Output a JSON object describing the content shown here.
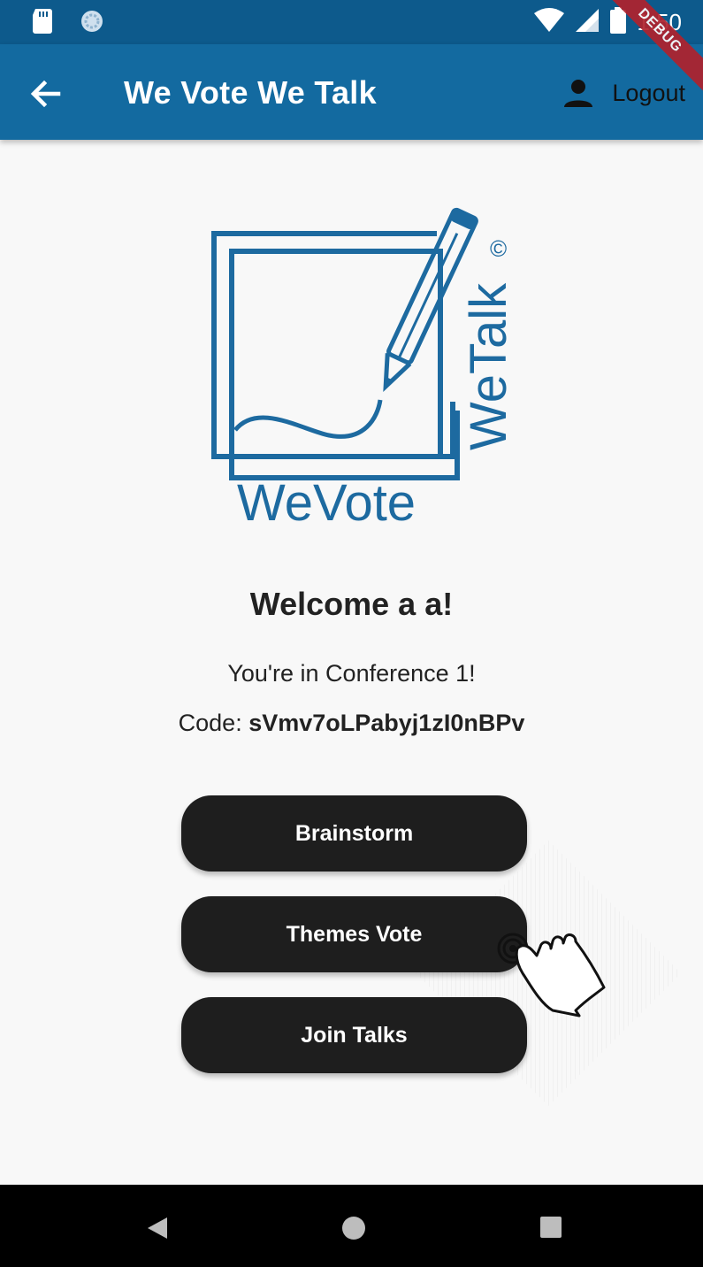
{
  "status_bar": {
    "time": "1:50",
    "icons": [
      "sd-card-icon",
      "sync-icon",
      "wifi-icon",
      "signal-icon",
      "battery-icon"
    ]
  },
  "app_bar": {
    "title": "We Vote We Talk",
    "logout_label": "Logout",
    "back_icon": "arrow-back-icon",
    "user_icon": "person-icon",
    "color": "#136aa0"
  },
  "debug_banner": "DEBUG",
  "logo": {
    "primary_text": "WeVote",
    "secondary_text": "WeTalk",
    "copyright": "©",
    "color": "#1d6aa0"
  },
  "welcome": {
    "greeting": "Welcome a a!",
    "conference_text": "You're in Conference 1!",
    "code_label": "Code:",
    "code_value": "sVmv7oLPabyj1zI0nBPv"
  },
  "actions": {
    "brainstorm": "Brainstorm",
    "themes_vote": "Themes Vote",
    "join_talks": "Join Talks"
  },
  "nav_bar": {
    "icons": [
      "nav-back-icon",
      "nav-home-icon",
      "nav-recents-icon"
    ]
  }
}
